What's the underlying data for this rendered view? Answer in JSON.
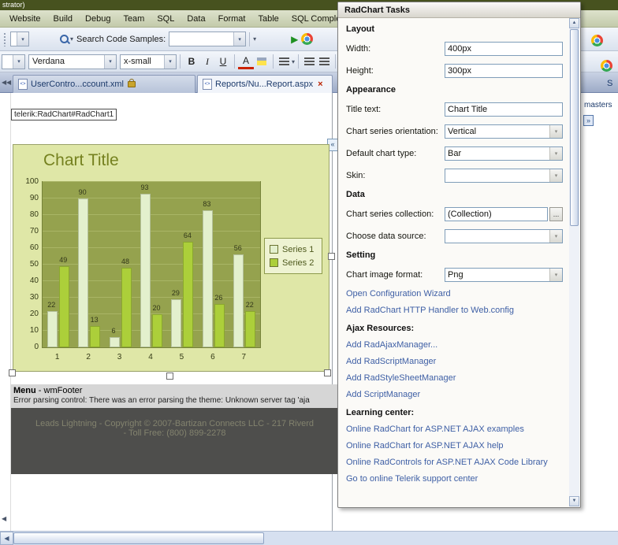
{
  "window": {
    "title": "strator)"
  },
  "menubar": {
    "items": [
      "Website",
      "Build",
      "Debug",
      "Team",
      "SQL",
      "Data",
      "Format",
      "Table",
      "SQL Comple"
    ]
  },
  "toolbar": {
    "search_label": "Search Code Samples:",
    "play_icon": "▶",
    "dropdown_icon": "▾"
  },
  "format_bar": {
    "font": "Verdana",
    "size": "x-small",
    "bold": "B",
    "italic": "I",
    "underline": "U",
    "font_color": "A"
  },
  "tabstrip": {
    "tabs": [
      {
        "label": "UserContro...ccount.xml"
      },
      {
        "label": "Reports/Nu...Report.aspx",
        "close": "×"
      }
    ]
  },
  "design": {
    "control_tag": "telerik:RadChart#RadChart1",
    "smart_tag_chevron": "«",
    "menu_label": "Menu",
    "menu_label_suffix": " - wmFooter",
    "error_text": "Error parsing control: There was an error parsing the theme: Unknown server tag 'aja",
    "footer_line1": "Leads Lightning - Copyright © 2007-Bartizan Connects LLC - 217 Riverd",
    "footer_line2": "- Toll Free: (800) 899-2278"
  },
  "edge": {
    "fragment_masters": "masters",
    "fragment_s": "S",
    "chevron": "»"
  },
  "colors": {
    "link": "#3e5fa5",
    "titlebar": "#47521f",
    "chart_bg": "#dfe7a7",
    "plot_bg": "#95a24e"
  },
  "chart_data": {
    "type": "bar",
    "title": "Chart Title",
    "categories": [
      "1",
      "2",
      "3",
      "4",
      "5",
      "6",
      "7"
    ],
    "series": [
      {
        "name": "Series 1",
        "color": "#e3f0cd",
        "values": [
          22,
          90,
          6,
          93,
          29,
          83,
          56
        ]
      },
      {
        "name": "Series 2",
        "color": "#accf3a",
        "values": [
          49,
          13,
          48,
          20,
          64,
          26,
          22
        ]
      }
    ],
    "ylim": [
      0,
      100
    ],
    "yticks": [
      0,
      10,
      20,
      30,
      40,
      50,
      60,
      70,
      80,
      90,
      100
    ],
    "grid": true,
    "legend_position": "right",
    "xlabel": "",
    "ylabel": ""
  },
  "tasks_panel": {
    "title": "RadChart Tasks",
    "sections": [
      "Layout",
      "Appearance",
      "Data",
      "Setting"
    ],
    "fields": [
      {
        "label": "Width:",
        "value": "400px",
        "control": "text"
      },
      {
        "label": "Height:",
        "value": "300px",
        "control": "text"
      },
      {
        "label": "Title text:",
        "value": "Chart Title",
        "control": "text"
      },
      {
        "label": "Chart series orientation:",
        "value": "Vertical",
        "control": "combo"
      },
      {
        "label": "Default chart type:",
        "value": "Bar",
        "control": "combo"
      },
      {
        "label": "Skin:",
        "value": "",
        "control": "combo"
      },
      {
        "label": "Chart series collection:",
        "value": "(Collection)",
        "control": "ellipsis"
      },
      {
        "label": "Choose data source:",
        "value": "",
        "control": "combo"
      },
      {
        "label": "Chart image format:",
        "value": "Png",
        "control": "combo"
      }
    ],
    "ellipsis": "...",
    "links_config": [
      "Open Configuration Wizard",
      "Add RadChart HTTP Handler to Web.config"
    ],
    "ajax_header": "Ajax Resources:",
    "ajax_links": [
      "Add RadAjaxManager...",
      "Add RadScriptManager",
      "Add RadStyleSheetManager",
      "Add ScriptManager"
    ],
    "learning_header": "Learning center:",
    "learning_links": [
      "Online RadChart for ASP.NET AJAX examples",
      "Online RadChart for ASP.NET AJAX help",
      "Online RadControls for ASP.NET AJAX Code Library",
      "Go to online Telerik support center"
    ]
  }
}
